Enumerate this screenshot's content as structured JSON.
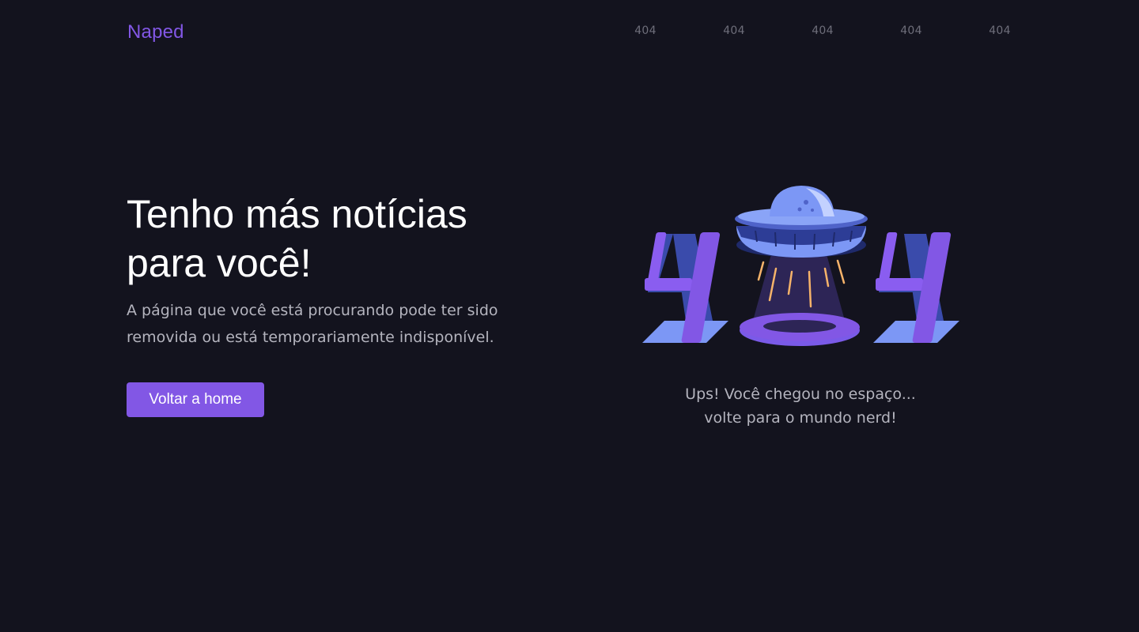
{
  "header": {
    "logo": "Naped",
    "nav": [
      "404",
      "404",
      "404",
      "404",
      "404"
    ]
  },
  "hero": {
    "title_line1": "Tenho más notícias",
    "title_line2": "para você!",
    "subtitle_line1": "A página que você está procurando pode ter sido",
    "subtitle_line2": "removida ou está temporariamente indisponível.",
    "button_label": "Voltar a home"
  },
  "illustration": {
    "icon": "ufo-404-illustration",
    "caption_line1": "Ups! Você chegou no espaço...",
    "caption_line2": "volte para o mundo nerd!"
  },
  "colors": {
    "background": "#13131e",
    "accent": "#8257e5",
    "text_primary": "#ffffff",
    "text_secondary": "#b4b4be",
    "nav_text": "#6e6e7a"
  }
}
